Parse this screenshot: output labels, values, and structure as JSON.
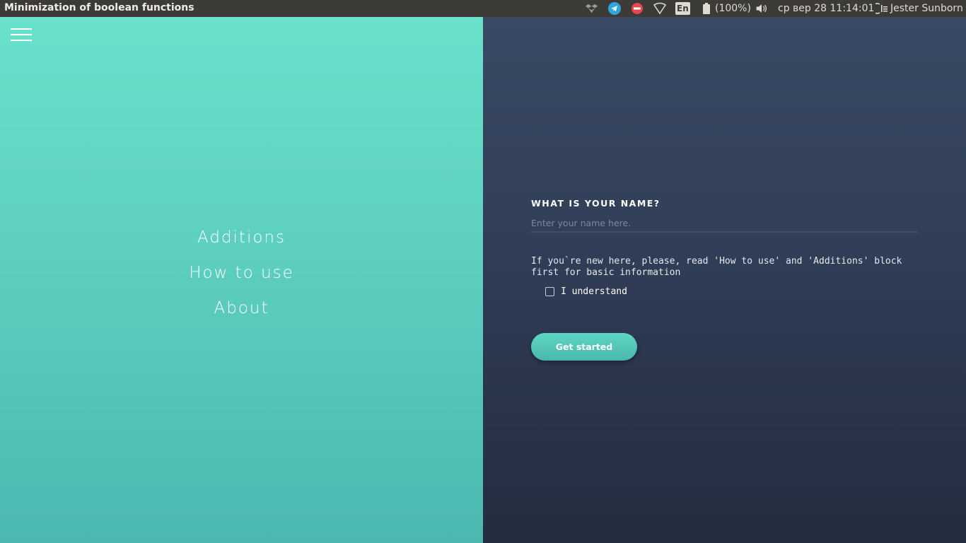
{
  "topbar": {
    "window_title": "Minimization of boolean functions",
    "keyboard_layout": "En",
    "battery": "(100%)",
    "datetime": "ср вер 28 11:14:01",
    "user": "Jester Sunborn",
    "icons": [
      "dropbox-icon",
      "telegram-icon",
      "stop-icon",
      "wifi-icon",
      "keyboard-layout-icon",
      "battery-icon",
      "volume-icon",
      "session-icon"
    ]
  },
  "nav": {
    "items": [
      "Additions",
      "How to use",
      "About"
    ]
  },
  "form": {
    "label": "WHAT IS YOUR NAME?",
    "placeholder": "Enter your name here.",
    "info": "If you`re new here, please, read 'How to use' and 'Additions' block first for basic information",
    "checkbox_label": "I understand",
    "checkbox_checked": false,
    "submit_label": "Get started"
  },
  "colors": {
    "left_panel_top": "#69e1cb",
    "left_panel_bottom": "#4ab8af",
    "right_panel_top": "#3a4a64",
    "right_panel_bottom": "#242c3f",
    "button": "#53c6b7",
    "topbar": "#3c3b37"
  }
}
